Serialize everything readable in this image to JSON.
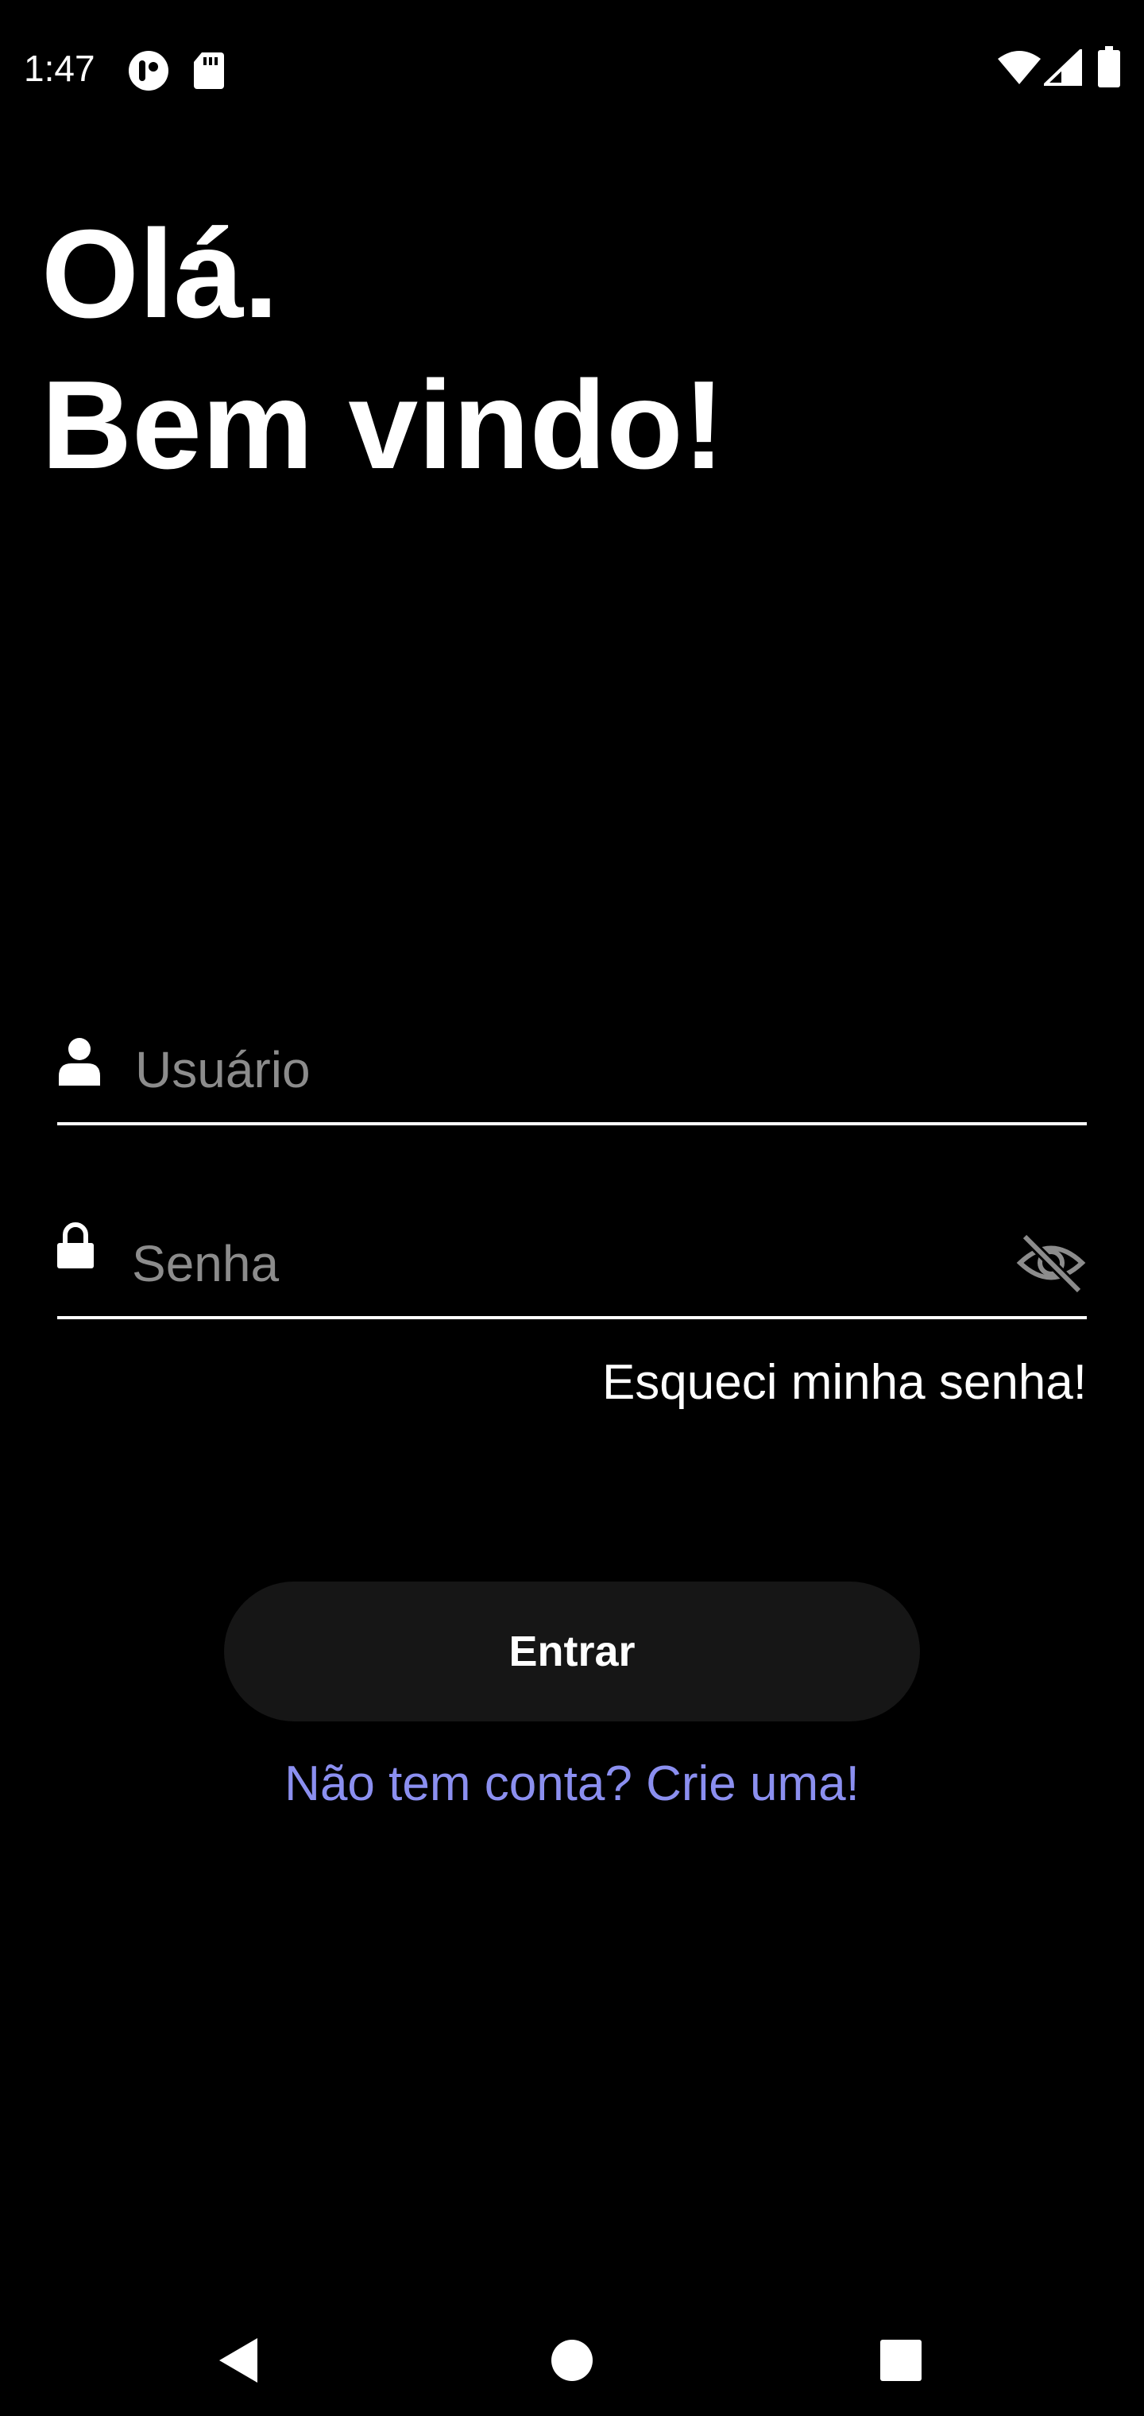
{
  "status_bar": {
    "time": "1:47",
    "icons": [
      "notification-app-icon",
      "sd-card-icon",
      "wifi-icon",
      "cellular-signal-icon",
      "battery-icon"
    ]
  },
  "greeting": {
    "line1": "Olá.",
    "line2": "Bem vindo!"
  },
  "form": {
    "username_placeholder": "Usuário",
    "username_value": "",
    "password_placeholder": "Senha",
    "password_value": "",
    "password_visibility": "hidden",
    "forgot_password": "Esqueci minha senha!",
    "login_button": "Entrar",
    "signup_link": "Não tem conta? Crie uma!"
  },
  "nav_bar": {
    "icons": [
      "back-icon",
      "home-icon",
      "recents-icon"
    ]
  },
  "colors": {
    "background": "#000000",
    "text": "#ffffff",
    "placeholder": "#8c8c8c",
    "button_bg": "#161616",
    "link_accent": "#8b8ff0"
  }
}
